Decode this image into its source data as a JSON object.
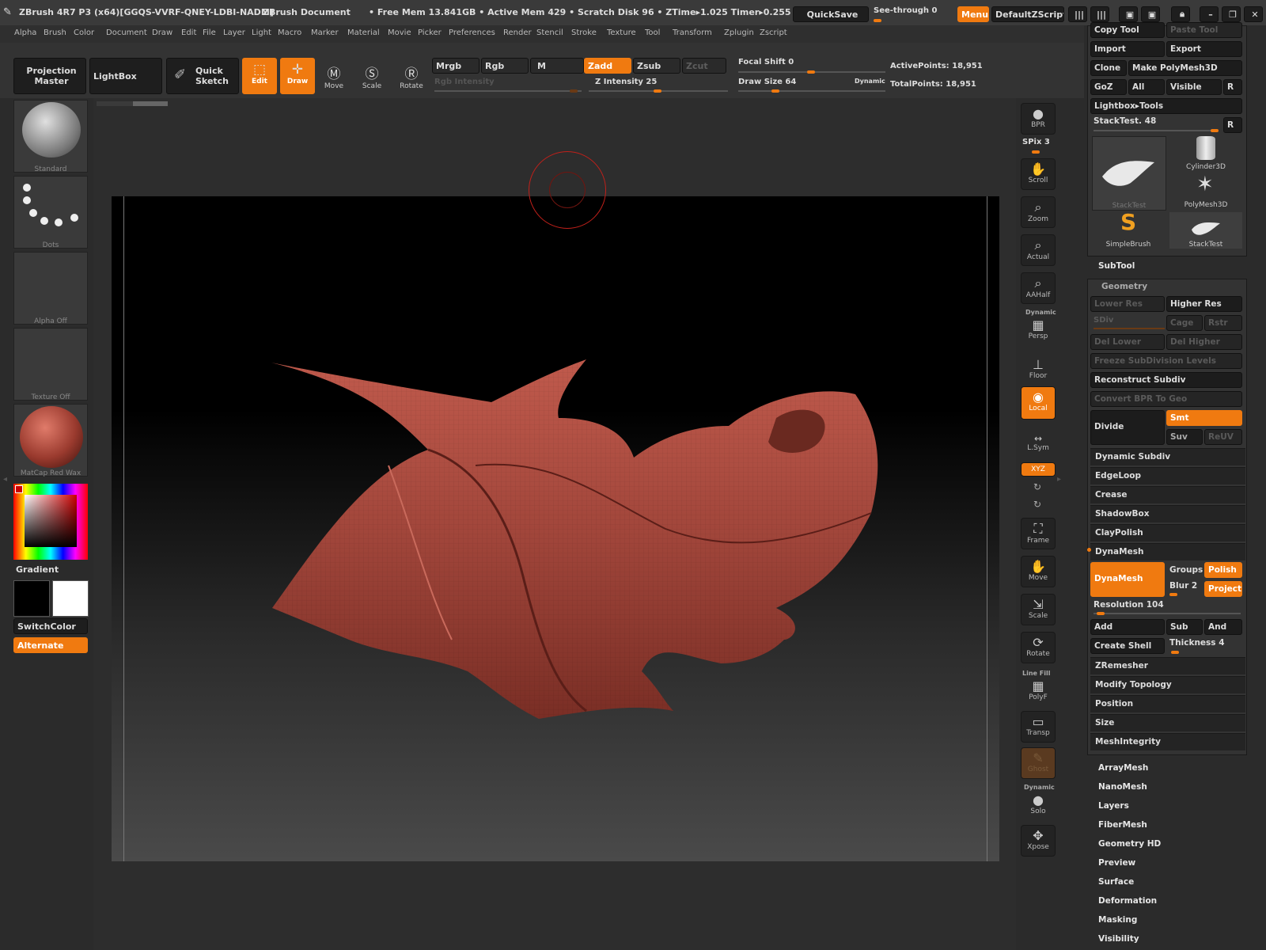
{
  "title": {
    "app": "ZBrush 4R7 P3 (x64)[GGQS-VVRF-QNEY-LDBI-NADM]",
    "document": "ZBrush Document",
    "stats": "• Free Mem 13.841GB • Active Mem 429 • Scratch Disk 96 • ZTime▸1.025 Timer▸0.255",
    "quicksave": "QuickSave",
    "see_through": "See-through  0",
    "menus": "Menus",
    "script": "DefaultZScript"
  },
  "menu": [
    "Alpha",
    "Brush",
    "Color",
    "Document",
    "Draw",
    "Edit",
    "File",
    "Layer",
    "Light",
    "Macro",
    "Marker",
    "Material",
    "Movie",
    "Picker",
    "Preferences",
    "Render",
    "Stencil",
    "Stroke",
    "Texture",
    "Tool",
    "Transform",
    "Zplugin",
    "Zscript"
  ],
  "toolbar": {
    "projection_master": "Projection Master",
    "lightbox": "LightBox",
    "quick_sketch": "Quick Sketch",
    "edit": "Edit",
    "draw": "Draw",
    "move": "Move",
    "scale": "Scale",
    "rotate": "Rotate",
    "mrgb": "Mrgb",
    "rgb": "Rgb",
    "m": "M",
    "zadd": "Zadd",
    "zsub": "Zsub",
    "zcut": "Zcut",
    "rgb_intensity": "Rgb Intensity",
    "z_intensity": "Z Intensity 25",
    "focal_shift": "Focal Shift 0",
    "draw_size": "Draw Size 64",
    "dynamic": "Dynamic",
    "active_points": "ActivePoints: 18,951",
    "total_points": "TotalPoints: 18,951"
  },
  "left": {
    "brush": "Standard",
    "stroke": "Dots",
    "alpha": "Alpha Off",
    "texture": "Texture Off",
    "material": "MatCap Red Wax",
    "gradient": "Gradient",
    "switch_color": "SwitchColor",
    "alternate": "Alternate"
  },
  "right_shelf": [
    {
      "label": "BPR",
      "icon": "sphere-icon"
    },
    {
      "label": "SPix 3",
      "icon": ""
    },
    {
      "label": "Scroll",
      "icon": "hand-icon"
    },
    {
      "label": "Zoom",
      "icon": "zoom-icon"
    },
    {
      "label": "Actual",
      "icon": "actual-icon"
    },
    {
      "label": "AAHalf",
      "icon": "aahalf-icon"
    },
    {
      "label": "Persp",
      "icon": "persp-icon"
    },
    {
      "label": "Floor",
      "icon": "floor-icon"
    },
    {
      "label": "Local",
      "icon": "local-icon"
    },
    {
      "label": "L.Sym",
      "icon": "lsym-icon"
    },
    {
      "label": "XYZ",
      "icon": "xyz-icon"
    },
    {
      "label": "Frame",
      "icon": "frame-icon"
    },
    {
      "label": "Move",
      "icon": "move-icon"
    },
    {
      "label": "Scale",
      "icon": "scale-icon"
    },
    {
      "label": "Rotate",
      "icon": "rotate-icon"
    },
    {
      "label": "PolyF",
      "icon": "polyf-icon"
    },
    {
      "label": "Transp",
      "icon": "transp-icon"
    },
    {
      "label": "Ghost",
      "icon": "ghost-icon"
    },
    {
      "label": "Solo",
      "icon": "solo-icon"
    },
    {
      "label": "Xpose",
      "icon": "xpose-icon"
    }
  ],
  "right_shelf_extra": {
    "dynamic": "Dynamic",
    "line_fill": "Line Fill",
    "dynamic2": "Dynamic"
  },
  "tool": {
    "copy_tool": "Copy Tool",
    "paste_tool": "Paste Tool",
    "import": "Import",
    "export": "Export",
    "clone": "Clone",
    "make_polymesh": "Make PolyMesh3D",
    "goz": "GoZ",
    "all": "All",
    "visible": "Visible",
    "r": "R",
    "lightbox_tools": "Lightbox▸Tools",
    "stacktest": "StackTest. 48",
    "thumbs": [
      "StackTest",
      "Cylinder3D",
      "PolyMesh3D",
      "SimpleBrush",
      "StackTest"
    ]
  },
  "subtool": "SubTool",
  "geometry": {
    "header": "Geometry",
    "lower_res": "Lower Res",
    "higher_res": "Higher Res",
    "sdiv": "SDiv",
    "cage": "Cage",
    "rstr": "Rstr",
    "del_lower": "Del Lower",
    "del_higher": "Del Higher",
    "freeze": "Freeze SubDivision Levels",
    "reconstruct": "Reconstruct Subdiv",
    "convert_bpr": "Convert BPR To Geo",
    "divide": "Divide",
    "smt": "Smt",
    "suv": "Suv",
    "reuv": "ReUV",
    "rows": [
      "Dynamic Subdiv",
      "EdgeLoop",
      "Crease",
      "ShadowBox",
      "ClayPolish"
    ],
    "dynamesh_header": "DynaMesh",
    "dynamesh": "DynaMesh",
    "groups": "Groups",
    "polish": "Polish",
    "blur": "Blur 2",
    "project": "Project",
    "resolution": "Resolution 104",
    "add": "Add",
    "sub": "Sub",
    "and": "And",
    "create_shell": "Create Shell",
    "thickness": "Thickness 4",
    "rows2": [
      "ZRemesher",
      "Modify Topology",
      "Position",
      "Size",
      "MeshIntegrity"
    ]
  },
  "sections": [
    "ArrayMesh",
    "NanoMesh",
    "Layers",
    "FiberMesh",
    "Geometry HD",
    "Preview",
    "Surface",
    "Deformation",
    "Masking",
    "Visibility"
  ],
  "colors": {
    "accent": "#f07a10",
    "mesh": "#a0453a",
    "panel": "#2b2b2b"
  }
}
